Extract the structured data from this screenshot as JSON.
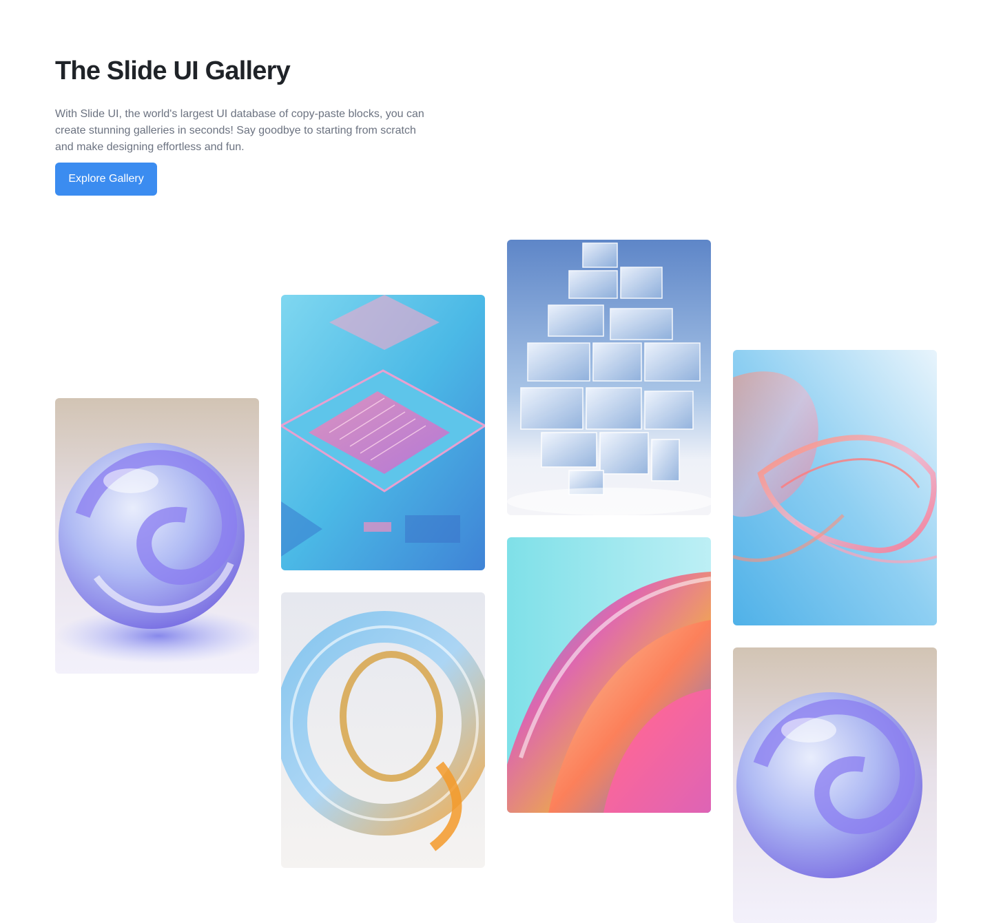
{
  "hero": {
    "title": "The Slide UI Gallery",
    "description": "With Slide UI, the world's largest UI database of copy-paste blocks, you can create stunning galleries in seconds! Say goodbye to starting from scratch and make designing effortless and fun.",
    "cta_label": "Explore Gallery"
  },
  "colors": {
    "accent": "#3b8cf0",
    "title": "#1f2328",
    "body_text": "#6b7280"
  },
  "gallery": [
    {
      "name": "glass-sphere-purple"
    },
    {
      "name": "circuit-chip-pink-blue"
    },
    {
      "name": "glass-ring-gold"
    },
    {
      "name": "glass-cube-tower"
    },
    {
      "name": "iridescent-swirl"
    },
    {
      "name": "glass-ribbon-coral"
    },
    {
      "name": "glass-sphere-purple"
    }
  ]
}
